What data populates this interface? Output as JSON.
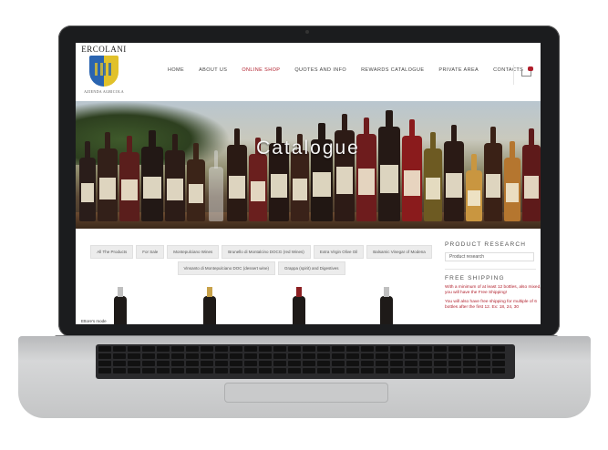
{
  "brand": {
    "name": "ERCOLANI",
    "subtitle": "AZIENDA AGRICOLA"
  },
  "nav": {
    "items": [
      {
        "label": "HOME",
        "active": false
      },
      {
        "label": "ABOUT US",
        "active": false
      },
      {
        "label": "ONLINE SHOP",
        "active": true
      },
      {
        "label": "QUOTES AND INFO",
        "active": false
      },
      {
        "label": "REWARDS CATALOGUE",
        "active": false
      },
      {
        "label": "PRIVATE AREA",
        "active": false
      },
      {
        "label": "CONTACTS",
        "active": false
      }
    ]
  },
  "hero": {
    "title": "Catalogue"
  },
  "categories": [
    "All The Products",
    "For Sale",
    "Montepulciano Wines",
    "Brunello di Montalcino DOCG (red Wines)",
    "Extra Virgin Olive Oil",
    "Balsamic Vinegar of Modena",
    "Vinsanto di Montepulciano DOC (dessert wine)",
    "Grappa (spirit) and Digestives"
  ],
  "sidebar": {
    "research_title": "PRODUCT RESEARCH",
    "research_placeholder": "Product research",
    "shipping_title": "FREE SHIPPING",
    "shipping_text_1": "With a minimum of at least 12 bottles, also mixed, you will have the Free Shipping!",
    "shipping_text_2": "You will also have free shipping for multiple of 6 bottles after the first 12. Ex: 18, 24, 30"
  },
  "featured_label": "Ettore's mode",
  "colors": {
    "accent": "#b01e2b",
    "nav_text": "#444444",
    "category_bg": "#ececec"
  }
}
